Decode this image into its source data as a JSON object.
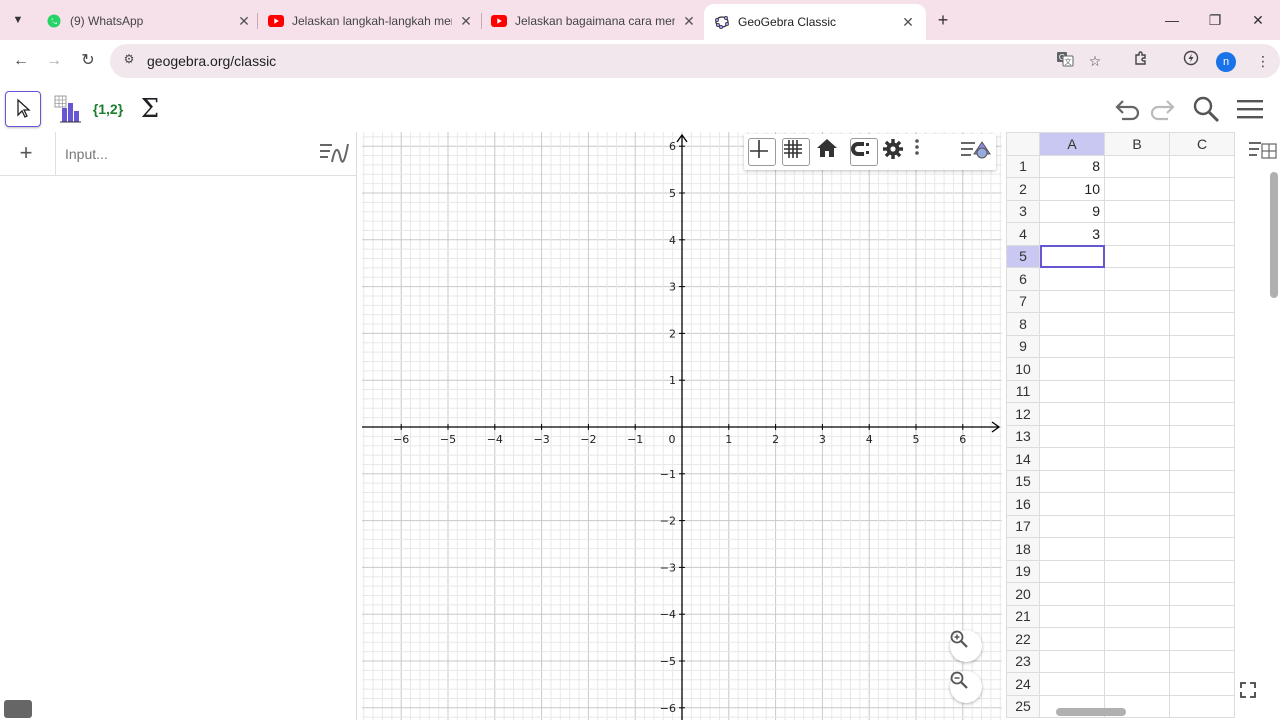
{
  "browser": {
    "tabs": [
      {
        "title": "(9) WhatsApp",
        "icon": "whatsapp-icon",
        "active": false
      },
      {
        "title": "Jelaskan langkah-langkah meng",
        "icon": "youtube-icon",
        "active": false
      },
      {
        "title": "Jelaskan bagaimana cara mene",
        "icon": "youtube-icon",
        "active": false
      },
      {
        "title": "GeoGebra Classic",
        "icon": "geogebra-icon",
        "active": true
      }
    ],
    "url": "geogebra.org/classic",
    "profile_initial": "n"
  },
  "geogebra": {
    "tools": [
      {
        "name": "move-tool",
        "label": ""
      },
      {
        "name": "chart-tool",
        "label": ""
      },
      {
        "name": "list-tool",
        "label": "{1,2}"
      },
      {
        "name": "sum-tool",
        "label": "Σ"
      }
    ],
    "algebra_input_placeholder": "Input...",
    "graphics": {
      "x_ticks": [
        "−6",
        "−5",
        "−4",
        "−3",
        "−2",
        "−1",
        "0",
        "1",
        "2",
        "3",
        "4",
        "5",
        "6"
      ],
      "y_ticks_pos": [
        "6",
        "5",
        "4",
        "3",
        "2",
        "1"
      ],
      "y_ticks_neg": [
        "−1",
        "−2",
        "−3",
        "−4",
        "−5",
        "−6"
      ],
      "grid": true,
      "axis_color": "#000000",
      "grid_major_color": "#c8c8c8",
      "grid_minor_color": "#e8e8e8"
    },
    "spreadsheet": {
      "columns": [
        "A",
        "B",
        "C"
      ],
      "selected_column": "A",
      "selected_row": "5",
      "rows": [
        {
          "n": "1",
          "A": "8",
          "B": "",
          "C": ""
        },
        {
          "n": "2",
          "A": "10",
          "B": "",
          "C": ""
        },
        {
          "n": "3",
          "A": "9",
          "B": "",
          "C": ""
        },
        {
          "n": "4",
          "A": "3",
          "B": "",
          "C": ""
        },
        {
          "n": "5",
          "A": "",
          "B": "",
          "C": ""
        },
        {
          "n": "6",
          "A": "",
          "B": "",
          "C": ""
        },
        {
          "n": "7",
          "A": "",
          "B": "",
          "C": ""
        },
        {
          "n": "8",
          "A": "",
          "B": "",
          "C": ""
        },
        {
          "n": "9",
          "A": "",
          "B": "",
          "C": ""
        },
        {
          "n": "10",
          "A": "",
          "B": "",
          "C": ""
        },
        {
          "n": "11",
          "A": "",
          "B": "",
          "C": ""
        },
        {
          "n": "12",
          "A": "",
          "B": "",
          "C": ""
        },
        {
          "n": "13",
          "A": "",
          "B": "",
          "C": ""
        },
        {
          "n": "14",
          "A": "",
          "B": "",
          "C": ""
        },
        {
          "n": "15",
          "A": "",
          "B": "",
          "C": ""
        },
        {
          "n": "16",
          "A": "",
          "B": "",
          "C": ""
        },
        {
          "n": "17",
          "A": "",
          "B": "",
          "C": ""
        },
        {
          "n": "18",
          "A": "",
          "B": "",
          "C": ""
        },
        {
          "n": "19",
          "A": "",
          "B": "",
          "C": ""
        },
        {
          "n": "20",
          "A": "",
          "B": "",
          "C": ""
        },
        {
          "n": "21",
          "A": "",
          "B": "",
          "C": ""
        },
        {
          "n": "22",
          "A": "",
          "B": "",
          "C": ""
        },
        {
          "n": "23",
          "A": "",
          "B": "",
          "C": ""
        },
        {
          "n": "24",
          "A": "",
          "B": "",
          "C": ""
        },
        {
          "n": "25",
          "A": "",
          "B": "",
          "C": ""
        }
      ]
    },
    "accent_color": "#6557d2"
  }
}
